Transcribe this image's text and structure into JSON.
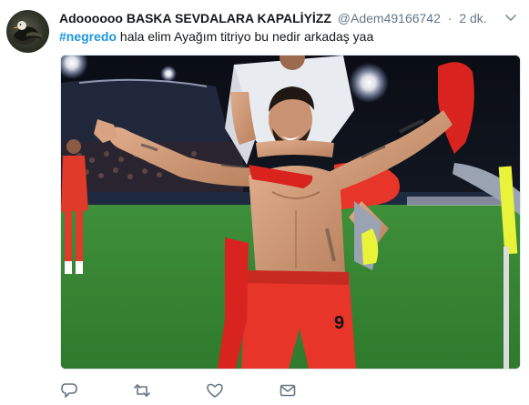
{
  "tweet": {
    "display_name": "Adoooooo BASKA SEVDALARA KAPALİYİZZ",
    "handle": "@Adem49166742",
    "separator": "·",
    "time": "2 dk.",
    "hashtag": "#negredo",
    "text": " hala elim Ayağım titriyo bu nedir arkadaş yaa"
  },
  "media": {
    "description_icon": "photo-football-celebration"
  },
  "actions": {
    "reply_icon": "reply-icon",
    "retweet_icon": "retweet-icon",
    "like_icon": "heart-icon",
    "message_icon": "envelope-icon"
  },
  "colors": {
    "hashtag": "#1b95e0",
    "muted": "#657786",
    "text": "#14171a"
  }
}
